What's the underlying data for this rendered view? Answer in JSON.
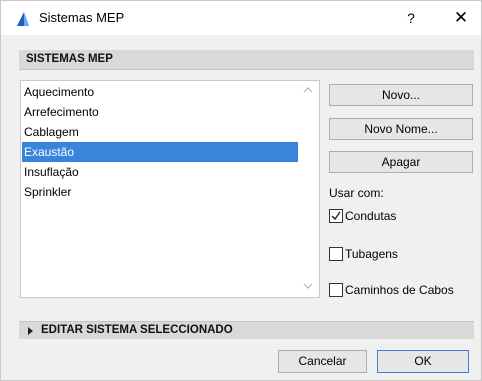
{
  "window": {
    "title": "Sistemas MEP",
    "help_label": "?",
    "close_label": "✕",
    "icon": "archicad-app-icon"
  },
  "section": {
    "title": "SISTEMAS MEP"
  },
  "systems": {
    "items": [
      {
        "label": "Aquecimento",
        "selected": false
      },
      {
        "label": "Arrefecimento",
        "selected": false
      },
      {
        "label": "Cablagem",
        "selected": false
      },
      {
        "label": "Exaustão",
        "selected": true
      },
      {
        "label": "Insuflação",
        "selected": false
      },
      {
        "label": "Sprinkler",
        "selected": false
      }
    ],
    "selection_color": "#3a85dc"
  },
  "actions": {
    "new_label": "Novo...",
    "rename_label": "Novo Nome...",
    "delete_label": "Apagar"
  },
  "usage": {
    "label": "Usar com:",
    "options": [
      {
        "label": "Condutas",
        "checked": true
      },
      {
        "label": "Tubagens",
        "checked": false
      },
      {
        "label": "Caminhos de Cabos",
        "checked": false
      }
    ]
  },
  "edit_section": {
    "title": "EDITAR SISTEMA SELECCIONADO",
    "expanded": false
  },
  "footer": {
    "cancel_label": "Cancelar",
    "ok_label": "OK",
    "ok_border_color": "#3c7fd1"
  }
}
